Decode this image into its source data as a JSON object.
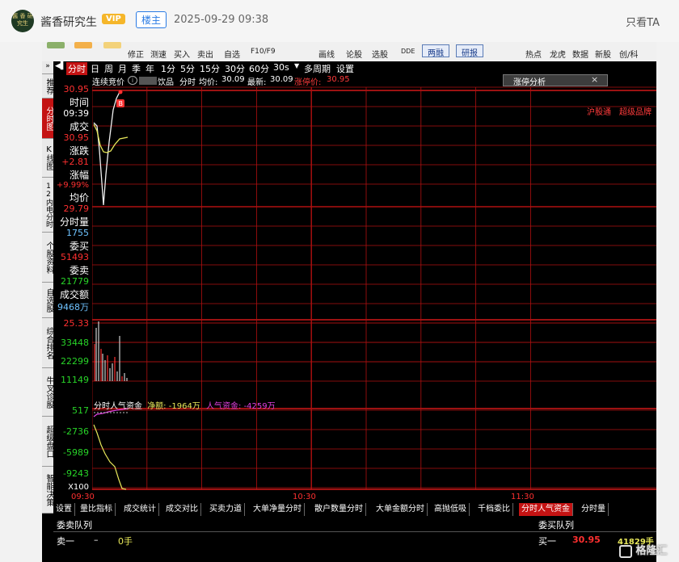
{
  "post": {
    "avatar_text": "酱 香 研究生",
    "username": "酱香研究生",
    "vip": "VIP",
    "floor_badge": "楼主",
    "timestamp": "2025-09-29 09:38",
    "only_ta": "只看TA"
  },
  "toolbar": {
    "items": [
      "修正",
      "测速",
      "买入",
      "卖出",
      "自选",
      "F10/F9",
      "画线",
      "论股",
      "选股",
      "DDE"
    ],
    "boxed": [
      "两融",
      "研报"
    ],
    "right_items": [
      "热点",
      "龙虎",
      "数据",
      "新股",
      "创/科"
    ]
  },
  "side_tabs": [
    "推荐",
    "分时图",
    "K线图",
    "12内电分时",
    "个股资料",
    "自选股",
    "综合排名",
    "牛叉诊股",
    "超级盘口",
    "智能决策"
  ],
  "period_tabs": [
    "分时",
    "日",
    "周",
    "月",
    "季",
    "年",
    "1分",
    "5分",
    "15分",
    "30分",
    "60分",
    "30s",
    "多周期",
    "设置"
  ],
  "info": {
    "series_label": "连续竞价",
    "stock_name": "饮品",
    "period": "分时",
    "avg_label": "均价:",
    "avg_value": "30.09",
    "last_label": "最新:",
    "last_value": "30.09",
    "limit_label": "涨停价:",
    "limit_value": "30.95",
    "analysis_tab": "涨停分析",
    "tags": [
      "沪股通",
      "超级品牌"
    ]
  },
  "quote": {
    "top_price": "30.95",
    "time_label": "时间",
    "time": "09:39",
    "deal_label": "成交",
    "deal": "30.95",
    "chg_label": "涨跌",
    "chg": "+2.81",
    "pct_label": "涨幅",
    "pct": "+9.99%",
    "avg_label": "均价",
    "avg": "29.79",
    "vol_label": "分时量",
    "vol": "1755",
    "buy_label": "委买",
    "buy": "51493",
    "sell_label": "委卖",
    "sell": "21779",
    "amt_label": "成交额",
    "amt": "9468万"
  },
  "volume_axis": [
    "25.33",
    "33448",
    "22299",
    "11149"
  ],
  "fund": {
    "title": "分时人气资金",
    "net_label": "净额:",
    "net": "-1964万",
    "pop_label": "人气资金:",
    "pop": "-4259万",
    "axis": [
      "517",
      "-2736",
      "-5989",
      "-9243"
    ],
    "scale": "X100"
  },
  "time_axis": [
    "09:30",
    "10:30",
    "11:30"
  ],
  "bottom_tabs": [
    "设置",
    "量比指标",
    "成交统计",
    "成交对比",
    "买卖力道",
    "大单净量分时",
    "散户数量分时",
    "大单金额分时",
    "高抛低吸",
    "千档委比",
    "分时人气资金",
    "分时量"
  ],
  "queue": {
    "left_title": "委卖队列",
    "right_title": "委买队列",
    "sell1_label": "卖一",
    "sell1_price": "–",
    "sell1_qty": "0手",
    "buy1_label": "买一",
    "buy1_price": "30.95",
    "buy1_qty": "41829手"
  },
  "watermark": "格隆汇",
  "colors": {
    "red": "#ff3030",
    "green": "#28d428",
    "limit": "#ff3b3b",
    "grid": "#b01010",
    "magenta": "#e040e0",
    "yellow": "#e8e85a"
  }
}
